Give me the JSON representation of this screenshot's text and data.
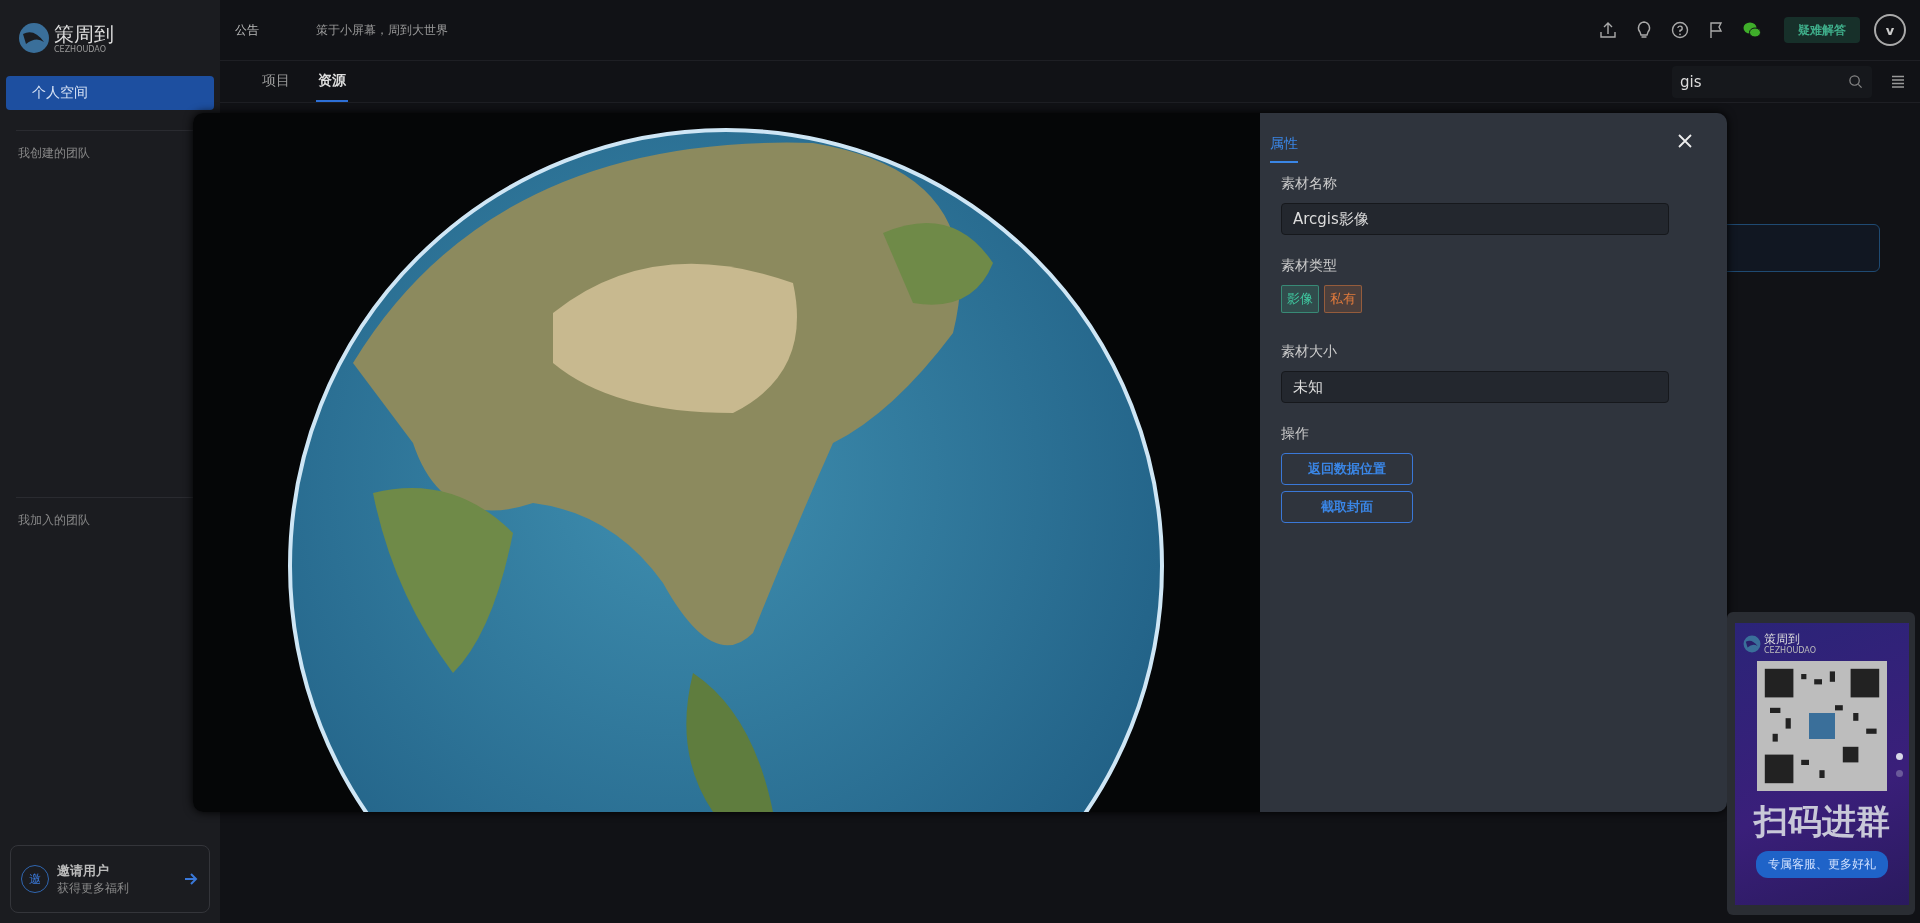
{
  "sidebar": {
    "logo": {
      "name": "策周到",
      "subtitle": "CEZHOUDAO"
    },
    "items": [
      {
        "label": "个人空间",
        "selected": true
      }
    ],
    "sections": [
      {
        "title": "我创建的团队"
      },
      {
        "title": "我加入的团队"
      }
    ],
    "invite": {
      "icon_text": "邀",
      "title": "邀请用户",
      "subtitle": "获得更多福利"
    }
  },
  "header": {
    "notice_label": "公告",
    "notice_text": "策于小屏幕，周到大世界",
    "help_button": "疑难解答",
    "avatar": "v"
  },
  "tabs": [
    {
      "label": "项目",
      "selected": false
    },
    {
      "label": "资源",
      "selected": true
    }
  ],
  "search": {
    "value": "gis"
  },
  "modal": {
    "tabs": [
      {
        "label": "属性",
        "selected": true
      }
    ],
    "fields": [
      {
        "kind": "input",
        "label": "素材名称",
        "value": "Arcgis影像"
      },
      {
        "kind": "tags",
        "label": "素材类型",
        "tags": [
          {
            "text": "影像",
            "color": "#3fc9a0"
          },
          {
            "text": "私有",
            "color": "#e07a3c"
          }
        ]
      },
      {
        "kind": "input",
        "label": "素材大小",
        "value": "未知"
      },
      {
        "kind": "buttons",
        "label": "操作",
        "buttons": [
          "返回数据位置",
          "截取封面"
        ]
      }
    ]
  },
  "qr_card": {
    "logo_name": "策周到",
    "logo_subtitle": "CEZHOUDAO",
    "title": "扫码进群",
    "subtitle": "专属客服、更多好礼",
    "slides": [
      {
        "selected": true
      },
      {
        "selected": false
      }
    ]
  }
}
